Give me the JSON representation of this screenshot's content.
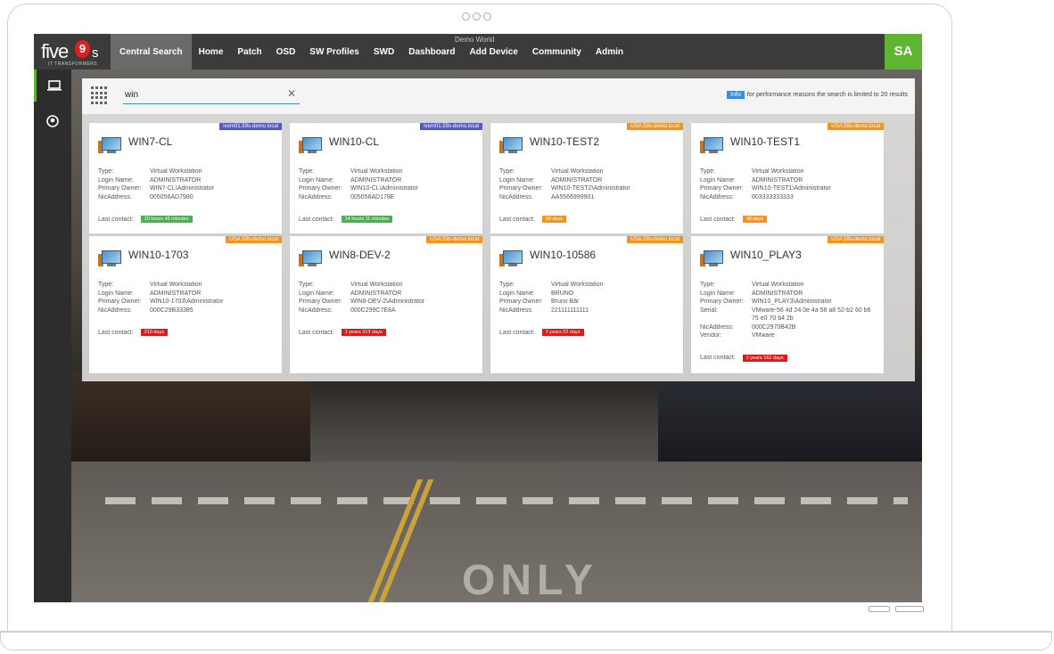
{
  "nav": {
    "logo_text": "five",
    "logo_nine": "9",
    "logo_s": "s",
    "logo_sub": "IT TRANSFORMERS",
    "items": [
      "Central Search",
      "Home",
      "Patch",
      "OSD",
      "SW Profiles",
      "SWD",
      "Dashboard",
      "Add Device",
      "Community",
      "Admin"
    ],
    "environment": "Demo World",
    "avatar": "SA"
  },
  "sidebar": {
    "items": [
      {
        "icon": "laptop-icon"
      },
      {
        "icon": "user-circle-icon"
      }
    ]
  },
  "search": {
    "query": "win",
    "info_badge": "Info",
    "info_text": "for performance reasons the search is limited to 20 results"
  },
  "labels": {
    "type": "Type:",
    "login": "Login Name:",
    "owner": "Primary Owner:",
    "nic": "NicAddress:",
    "serial": "Serial:",
    "vendor": "Vendor:",
    "last_contact": "Last contact:"
  },
  "cards": [
    {
      "name": "WIN7-CL",
      "domain": "ivem01.59s-demo.local",
      "domain_color": "#5458c8",
      "type": "Virtual Workstation",
      "login": "ADMINISTRATOR",
      "owner": "WIN7-CL\\Administrator",
      "nic": "005056AD7980",
      "contact": "10 hours 46 minutes",
      "contact_color": "#4caf50"
    },
    {
      "name": "WIN10-CL",
      "domain": "ivem01.59s-demo.local",
      "domain_color": "#5458c8",
      "type": "Virtual Workstation",
      "login": "ADMINISTRATOR",
      "owner": "WIN10-CL\\Administrator",
      "nic": "005056AD178E",
      "contact": "14 hours 11 minutes",
      "contact_color": "#4caf50"
    },
    {
      "name": "WIN10-TEST2",
      "domain": "USA.59s-demo.local",
      "domain_color": "#f39422",
      "type": "Virtual Workstation",
      "login": "ADMINISTRATOR",
      "owner": "WIN10-TEST2\\Administrator",
      "nic": "AA5566999901",
      "contact": "38 days",
      "contact_color": "#f39422"
    },
    {
      "name": "WIN10-TEST1",
      "domain": "USA.59s-demo.local",
      "domain_color": "#f39422",
      "type": "Virtual Workstation",
      "login": "ADMINISTRATOR",
      "owner": "WIN10-TEST1\\Administrator",
      "nic": "003333333333",
      "contact": "38 days",
      "contact_color": "#f39422"
    },
    {
      "name": "WIN10-1703",
      "domain": "USA.59s-demo.local",
      "domain_color": "#f39422",
      "type": "Virtual Workstation",
      "login": "ADMINISTRATOR",
      "owner": "WIN10-1703\\Administrator",
      "nic": "000C29B33385",
      "contact": "210 days",
      "contact_color": "#e01818"
    },
    {
      "name": "WIN8-DEV-2",
      "domain": "USA.59s-demo.local",
      "domain_color": "#f39422",
      "type": "Virtual Workstation",
      "login": "ADMINISTRATOR",
      "owner": "WIN8-DEV-2\\Administrator",
      "nic": "000C299C7E8A",
      "contact": "1 years 313 days",
      "contact_color": "#e01818"
    },
    {
      "name": "WIN10-10586",
      "domain": "USA.59s-demo.local",
      "domain_color": "#f39422",
      "type": "Virtual Workstation",
      "login": "BRUNO",
      "owner": "Bruno Bär",
      "nic": "221111111111",
      "contact": "2 years 22 days",
      "contact_color": "#e01818"
    },
    {
      "name": "WIN10_PLAY3",
      "domain": "USA.59s-demo.local",
      "domain_color": "#f39422",
      "type": "Virtual Workstation",
      "login": "ADMINISTRATOR",
      "owner": "WIN10_PLAY3\\Administrator",
      "serial": "VMware-56 4d 24 0e 4a 58 a8 52-b2 60 b6 75 e0 70 b4 2b",
      "nic": "000C2970B42B",
      "vendor": "VMware",
      "contact": "2 years 162 days",
      "contact_color": "#e01818"
    }
  ],
  "background": {
    "street_text": "ONLY"
  }
}
